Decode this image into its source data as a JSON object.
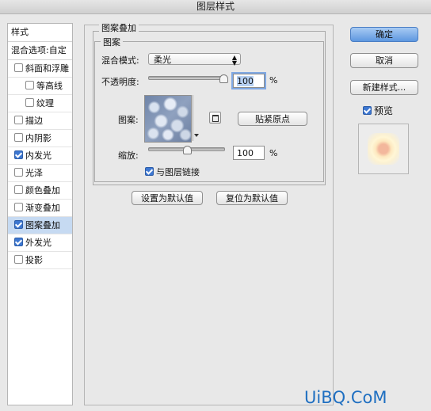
{
  "window": {
    "title": "图层样式"
  },
  "sidebar": {
    "header": "样式",
    "blend_options": "混合选项:自定",
    "items": [
      {
        "label": "斜面和浮雕",
        "checked": false,
        "indent": false,
        "selected": false
      },
      {
        "label": "等高线",
        "checked": false,
        "indent": true,
        "selected": false
      },
      {
        "label": "纹理",
        "checked": false,
        "indent": true,
        "selected": false
      },
      {
        "label": "描边",
        "checked": false,
        "indent": false,
        "selected": false
      },
      {
        "label": "内阴影",
        "checked": false,
        "indent": false,
        "selected": false
      },
      {
        "label": "内发光",
        "checked": true,
        "indent": false,
        "selected": false
      },
      {
        "label": "光泽",
        "checked": false,
        "indent": false,
        "selected": false
      },
      {
        "label": "颜色叠加",
        "checked": false,
        "indent": false,
        "selected": false
      },
      {
        "label": "渐变叠加",
        "checked": false,
        "indent": false,
        "selected": false
      },
      {
        "label": "图案叠加",
        "checked": true,
        "indent": false,
        "selected": true
      },
      {
        "label": "外发光",
        "checked": true,
        "indent": false,
        "selected": false
      },
      {
        "label": "投影",
        "checked": false,
        "indent": false,
        "selected": false
      }
    ]
  },
  "panel": {
    "section_title": "图案叠加",
    "group_title": "图案",
    "blend_mode_label": "混合模式:",
    "blend_mode_value": "柔光",
    "opacity_label": "不透明度:",
    "opacity_value": "100",
    "opacity_fraction": 1.0,
    "percent": "%",
    "pattern_label": "图案:",
    "snap_origin_button": "贴紧原点",
    "scale_label": "缩放:",
    "scale_value": "100",
    "link_label": "与图层链接",
    "link_checked": true,
    "make_default_button": "设置为默认值",
    "reset_default_button": "复位为默认值"
  },
  "actions": {
    "ok": "确定",
    "cancel": "取消",
    "new_style": "新建样式...",
    "preview_label": "预览",
    "preview_checked": true
  },
  "watermark": "UiBQ.CoM",
  "colors": {
    "accent": "#5e97e0",
    "selected_row": "#c6daf2",
    "watermark": "#1f6fc1"
  }
}
